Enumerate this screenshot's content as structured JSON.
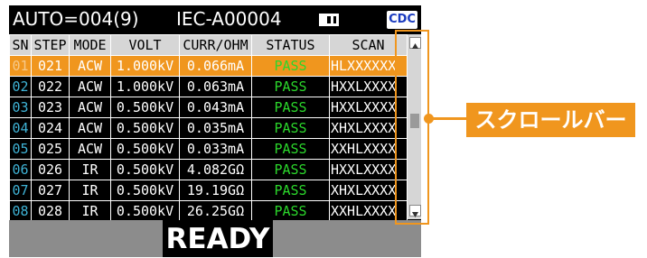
{
  "header": {
    "auto_text": "AUTO=004(9)",
    "iec_text": "IEC-A00004",
    "memory_icon": "memory-card-icon",
    "cdc_label": "CDC",
    "cdc_color": "#1b3bbf"
  },
  "table": {
    "columns": [
      "SN",
      "STEP",
      "MODE",
      "VOLT",
      "CURR/OHM",
      "STATUS",
      "SCAN"
    ],
    "rows": [
      [
        "01",
        "021",
        "ACW",
        "1.000kV",
        "0.066mA",
        "PASS",
        "HLXXXXXX"
      ],
      [
        "02",
        "022",
        "ACW",
        "1.000kV",
        "0.063mA",
        "PASS",
        "HXXLXXXX"
      ],
      [
        "03",
        "023",
        "ACW",
        "0.500kV",
        "0.043mA",
        "PASS",
        "HXXLXXXX"
      ],
      [
        "04",
        "024",
        "ACW",
        "0.500kV",
        "0.035mA",
        "PASS",
        "XHXLXXXX"
      ],
      [
        "05",
        "025",
        "ACW",
        "0.500kV",
        "0.033mA",
        "PASS",
        "XXHLXXXX"
      ],
      [
        "06",
        "026",
        "IR",
        "0.500kV",
        "4.082GΩ",
        "PASS",
        "HXXLXXXX"
      ],
      [
        "07",
        "027",
        "IR",
        "0.500kV",
        "19.19GΩ",
        "PASS",
        "XHXLXXXX"
      ],
      [
        "08",
        "028",
        "IR",
        "0.500kV",
        "26.25GΩ",
        "PASS",
        "XXHLXXXX"
      ]
    ],
    "selected_row_index": 0,
    "selected_color": "#f0961e",
    "pass_color": "#2bd62b",
    "sn_color": "#3fb3d6"
  },
  "statusbar": {
    "text": "READY"
  },
  "annotation": {
    "callout_text": "スクロールバー",
    "accent_color": "#f0961e"
  }
}
